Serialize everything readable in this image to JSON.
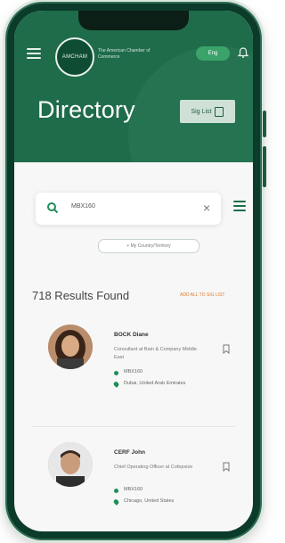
{
  "header": {
    "logo_text": "AMCHAM",
    "tagline": "The American Chamber of Commerce",
    "toggle_label": "Eng",
    "title": "Directory",
    "sig_list_label": "Sig List"
  },
  "search": {
    "value": "MBX160",
    "clear_symbol": "×"
  },
  "filter_chip": "+ My Country/Territory",
  "results": {
    "count_label": "718 Results Found",
    "add_all_label": "ADD ALL TO SIG LIST"
  },
  "people": [
    {
      "name": "BOCK Diane",
      "role": "Consultant at Bain & Company Middle East",
      "phone": "MBX160",
      "location": "Dubai, United Arab Emirates"
    },
    {
      "name": "CERF John",
      "role": "Chief Operating Officer at Cofepsize",
      "phone": "MBX160",
      "location": "Chicago, United States"
    }
  ],
  "colors": {
    "brand_green": "#1f6c4a",
    "accent_orange": "#e07a2e",
    "toggle_green": "#3aa36a"
  }
}
